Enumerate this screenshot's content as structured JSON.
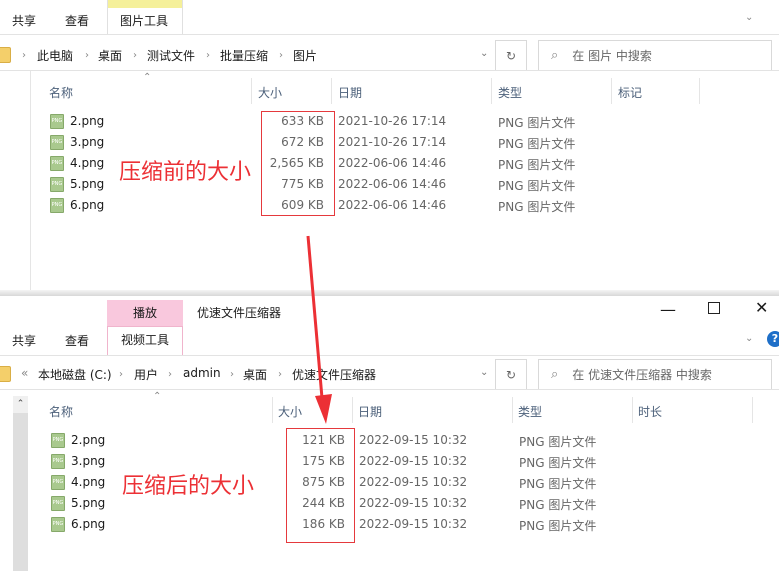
{
  "top_window": {
    "ribbon_tabs": [
      "共享",
      "查看"
    ],
    "context_tab": "图片工具",
    "breadcrumb": [
      "此电脑",
      "桌面",
      "测试文件",
      "批量压缩",
      "图片"
    ],
    "search_placeholder": "在 图片 中搜索",
    "columns": [
      "名称",
      "大小",
      "日期",
      "类型",
      "标记"
    ],
    "files": [
      {
        "name": "2.png",
        "size": "633 KB",
        "date": "2021-10-26 17:14",
        "type": "PNG 图片文件"
      },
      {
        "name": "3.png",
        "size": "672 KB",
        "date": "2021-10-26 17:14",
        "type": "PNG 图片文件"
      },
      {
        "name": "4.png",
        "size": "2,565 KB",
        "date": "2022-06-06 14:46",
        "type": "PNG 图片文件"
      },
      {
        "name": "5.png",
        "size": "775 KB",
        "date": "2022-06-06 14:46",
        "type": "PNG 图片文件"
      },
      {
        "name": "6.png",
        "size": "609 KB",
        "date": "2022-06-06 14:46",
        "type": "PNG 图片文件"
      }
    ],
    "annotation": "压缩前的大小"
  },
  "bottom_window": {
    "title": "优速文件压缩器",
    "ribbon_tabs": [
      "共享",
      "查看"
    ],
    "context_group": "播放",
    "context_tab": "视频工具",
    "breadcrumb_overflow": "«",
    "breadcrumb": [
      "本地磁盘 (C:)",
      "用户",
      "admin",
      "桌面",
      "优速文件压缩器"
    ],
    "search_placeholder": "在 优速文件压缩器 中搜索",
    "columns": [
      "名称",
      "大小",
      "日期",
      "类型",
      "时长"
    ],
    "files": [
      {
        "name": "2.png",
        "size": "121 KB",
        "date": "2022-09-15 10:32",
        "type": "PNG 图片文件"
      },
      {
        "name": "3.png",
        "size": "175 KB",
        "date": "2022-09-15 10:32",
        "type": "PNG 图片文件"
      },
      {
        "name": "4.png",
        "size": "875 KB",
        "date": "2022-09-15 10:32",
        "type": "PNG 图片文件"
      },
      {
        "name": "5.png",
        "size": "244 KB",
        "date": "2022-09-15 10:32",
        "type": "PNG 图片文件"
      },
      {
        "name": "6.png",
        "size": "186 KB",
        "date": "2022-09-15 10:32",
        "type": "PNG 图片文件"
      }
    ],
    "annotation": "压缩后的大小"
  },
  "colors": {
    "annotation": "#ec3035",
    "picture_tools": "#f5f09a",
    "video_tools": "#f9c8dd"
  }
}
